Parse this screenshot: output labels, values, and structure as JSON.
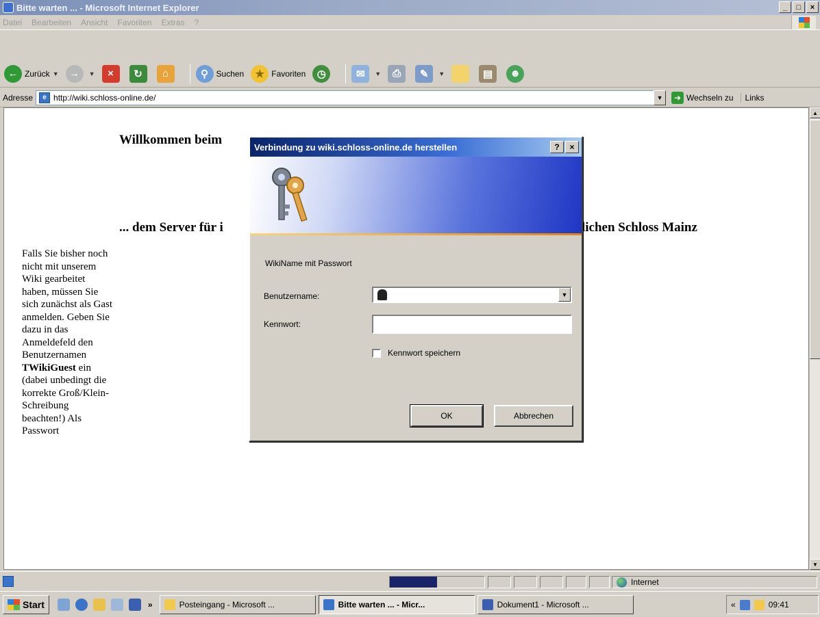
{
  "window": {
    "title": "Bitte warten ... - Microsoft Internet Explorer",
    "controls": [
      "_",
      "□",
      "×"
    ]
  },
  "menu": [
    "Datei",
    "Bearbeiten",
    "Ansicht",
    "Favoriten",
    "Extras",
    "?"
  ],
  "toolbar": {
    "back_label": "Zurück",
    "search_label": "Suchen",
    "favorites_label": "Favoriten"
  },
  "address": {
    "label": "Adresse",
    "url": "http://wiki.schloss-online.de/",
    "go_label": "Wechseln zu",
    "links_label": "Links"
  },
  "page": {
    "welcome": "Willkommen beim",
    "server_left": "... dem Server für i",
    "server_right": "lichen Schloss Mainz",
    "side_text_1": "Falls Sie bisher noch nicht mit unserem Wiki gearbeitet haben, müssen Sie sich zunächst als Gast anmelden. Geben Sie dazu in das Anmeldefeld den Benutzernamen",
    "side_text_bold": "TWikiGuest",
    "side_text_2": "ein (dabei unbedingt die korrekte Groß/Klein-Schreibung beachten!) Als Passwort"
  },
  "dialog": {
    "title": "Verbindung zu wiki.schloss-online.de herstellen",
    "help_label": "?",
    "close_label": "×",
    "realm": "WikiName mit Passwort",
    "username_label": "Benutzername:",
    "password_label": "Kennwort:",
    "remember_label": "Kennwort speichern",
    "ok_label": "OK",
    "cancel_label": "Abbrechen"
  },
  "status": {
    "zone": "Internet",
    "progress": 0.5
  },
  "taskbar": {
    "start_label": "Start",
    "tasks": [
      "Posteingang - Microsoft ...",
      "Bitte warten ... - Micr...",
      "Dokument1 - Microsoft ..."
    ],
    "clock": "09:41"
  },
  "colors": {
    "dialog_title": "#0a246a",
    "progress_fill": "#1a2468"
  }
}
